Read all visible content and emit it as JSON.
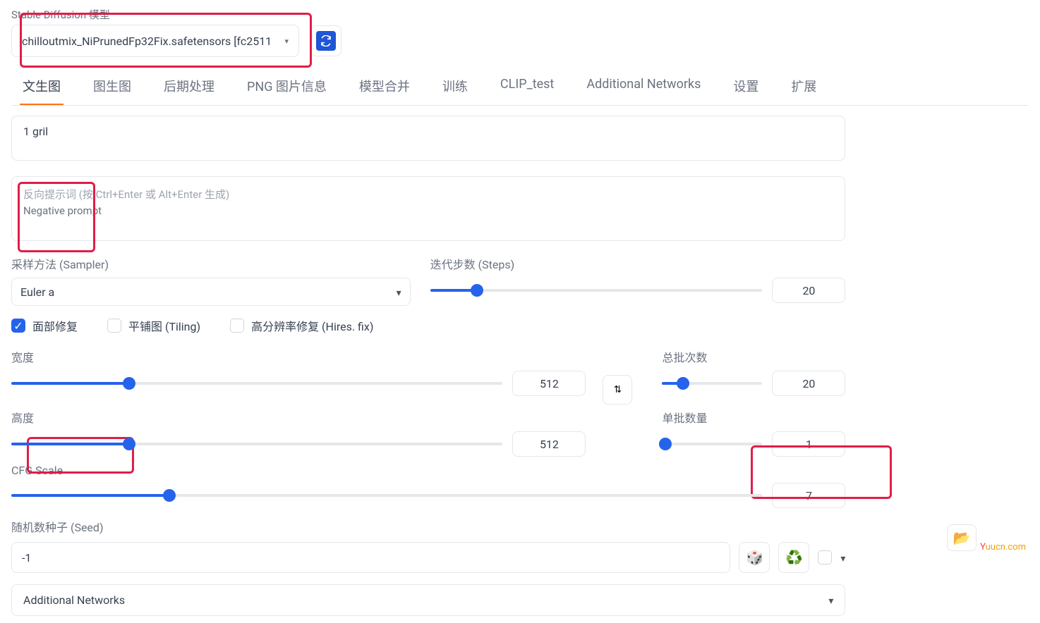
{
  "header": {
    "model_label": "Stable Diffusion 模型",
    "model_value": "chilloutmix_NiPrunedFp32Fix.safetensors [fc2511"
  },
  "tabs": [
    "文生图",
    "图生图",
    "后期处理",
    "PNG 图片信息",
    "模型合并",
    "训练",
    "CLIP_test",
    "Additional Networks",
    "设置",
    "扩展"
  ],
  "prompt": {
    "value": "1 gril",
    "neg_placeholder_cn": "反向提示词 (按 Ctrl+Enter 或 Alt+Enter 生成)",
    "neg_placeholder_en": "Negative prompt"
  },
  "sampler": {
    "label": "采样方法 (Sampler)",
    "value": "Euler a"
  },
  "steps": {
    "label": "迭代步数 (Steps)",
    "value": "20",
    "pct": 14
  },
  "checks": {
    "face": "面部修复",
    "tiling": "平铺图 (Tiling)",
    "hires": "高分辨率修复 (Hires. fix)"
  },
  "width": {
    "label": "宽度",
    "value": "512",
    "pct": 24
  },
  "height": {
    "label": "高度",
    "value": "512",
    "pct": 24
  },
  "batch_count": {
    "label": "总批次数",
    "value": "20",
    "pct": 21
  },
  "batch_size": {
    "label": "单批数量",
    "value": "1",
    "pct": 3
  },
  "cfg": {
    "label": "CFG Scale",
    "value": "7",
    "pct": 21
  },
  "seed": {
    "label": "随机数种子 (Seed)",
    "value": "-1"
  },
  "accordion": {
    "label": "Additional Networks"
  },
  "watermark": {
    "y": "Y",
    "rest": "uucn.com"
  }
}
